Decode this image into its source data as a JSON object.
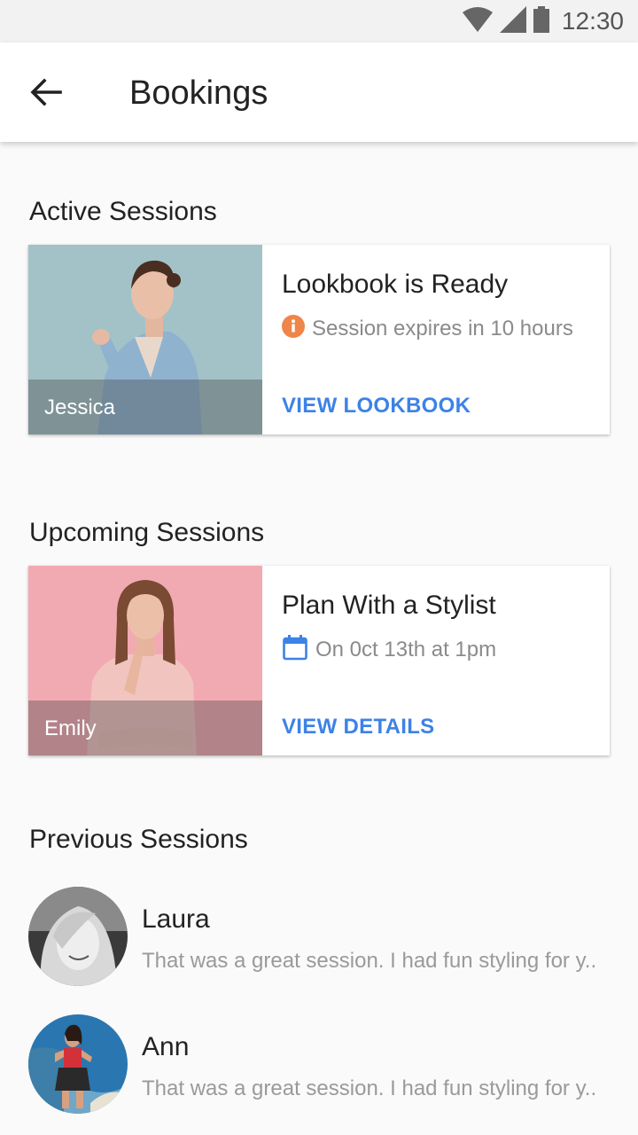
{
  "status_bar": {
    "time": "12:30",
    "icons": [
      "wifi-icon",
      "signal-icon",
      "battery-icon"
    ]
  },
  "app_bar": {
    "title": "Bookings",
    "back_icon": "arrow-back-icon"
  },
  "active": {
    "heading": "Active Sessions",
    "card": {
      "name": "Jessica",
      "title": "Lookbook is Ready",
      "meta": "Session expires in 10 hours",
      "meta_icon": "info-icon",
      "action": "VIEW LOOKBOOK"
    }
  },
  "upcoming": {
    "heading": "Upcoming Sessions",
    "card": {
      "name": "Emily",
      "title": "Plan With a Stylist",
      "meta": "On 0ct 13th at 1pm",
      "meta_icon": "calendar-icon",
      "action": "VIEW DETAILS"
    }
  },
  "previous": {
    "heading": "Previous Sessions",
    "items": [
      {
        "name": "Laura",
        "message": "That was a great session. I had fun styling for y.."
      },
      {
        "name": "Ann",
        "message": "That was a great session. I had fun styling for y.."
      }
    ]
  },
  "colors": {
    "accent": "#3d82e6",
    "info": "#f0854a",
    "app_bar": "#ffffff",
    "status_bar": "#f2f2f2"
  }
}
